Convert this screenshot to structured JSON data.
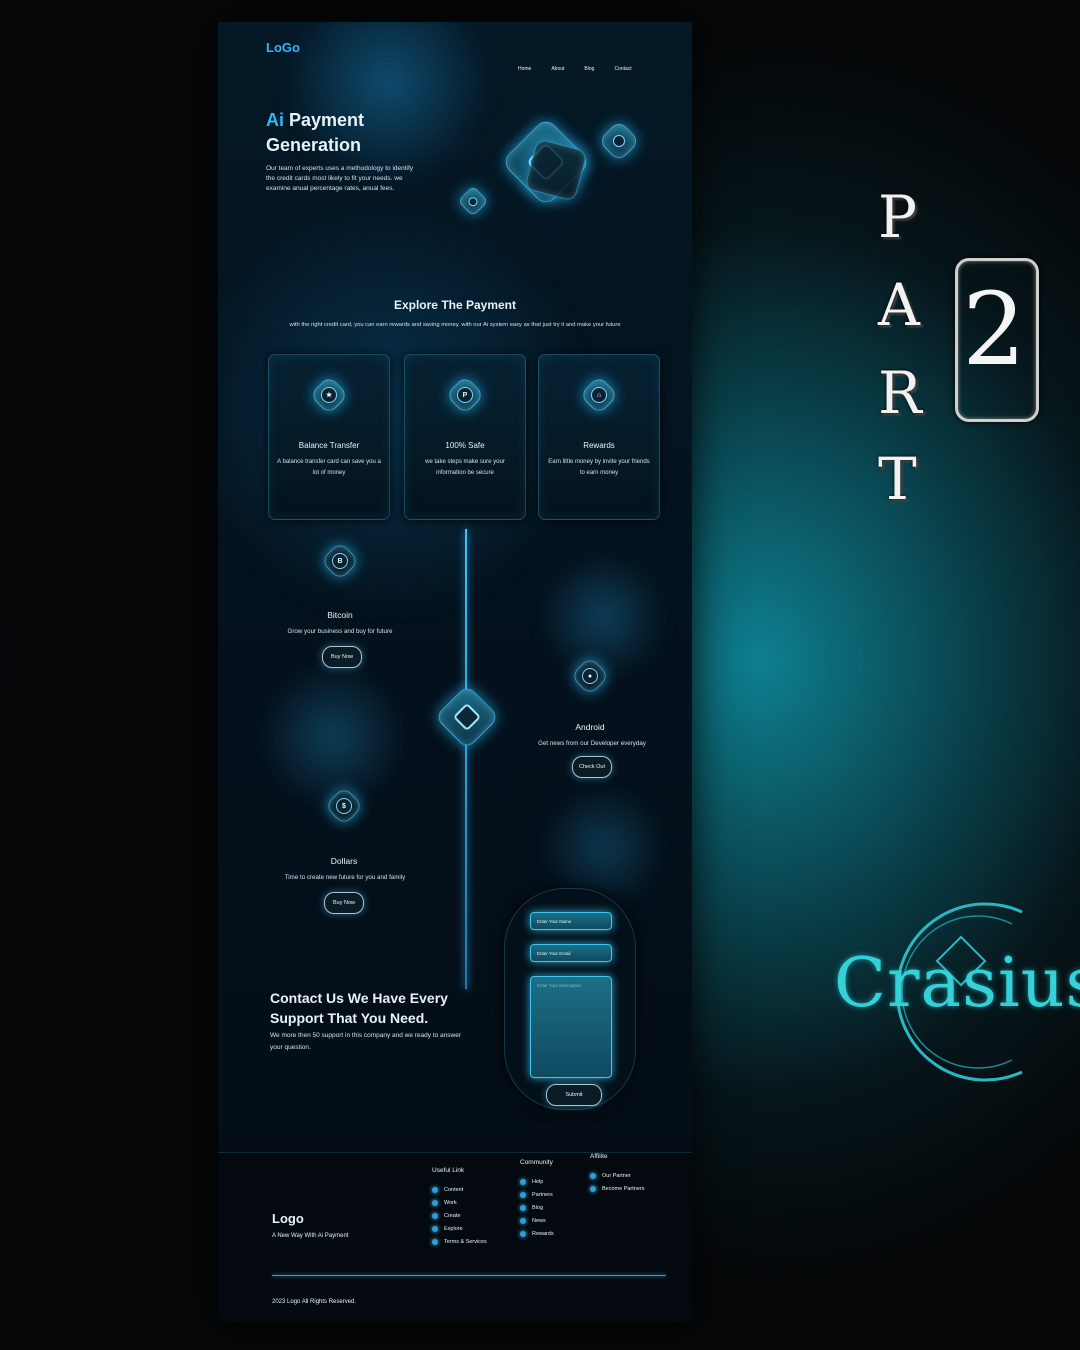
{
  "logo": {
    "part1": "Lo",
    "part2": "Go"
  },
  "nav": [
    "Home",
    "About",
    "Blog",
    "Contact"
  ],
  "hero": {
    "accent": "Ai",
    "title_rest": " Payment",
    "title_line2": "Generation",
    "description": "Our team of experts uses a methodology to identify the credit cards most likely to fit your needs. we examine anual percentage rates, anual fees."
  },
  "explore": {
    "title": "Explore The Payment",
    "subtitle": "with the right credit card, you can earn rewards and saving money. with our Ai system easy as that just try it and make your future"
  },
  "cards": [
    {
      "title": "Balance Transfer",
      "desc": "A balance transfer card can save you a lot of money",
      "icon": "★"
    },
    {
      "title": "100% Safe",
      "desc": "we take steps make sure your information be secure",
      "icon": "P"
    },
    {
      "title": "Rewards",
      "desc": "Earn little money by invite your friends to earn money",
      "icon": "⌂"
    }
  ],
  "features": [
    {
      "title": "Bitcoin",
      "desc": "Grow your business and buy for future",
      "button": "Buy Now",
      "icon": "B"
    },
    {
      "title": "Android",
      "desc": "Get news from our Developer everyday",
      "button": "Check Out",
      "icon": "●"
    },
    {
      "title": "Dollars",
      "desc": "Time to create new future for you and family",
      "button": "Buy Now",
      "icon": "$"
    }
  ],
  "contact": {
    "title": "Contact Us We Have Every Support That You Need.",
    "desc": "We more then 50 support in this company and we ready to answer your question.",
    "name_placeholder": "Enter Your Name",
    "email_placeholder": "Enter Your Email",
    "message_placeholder": "Enter Your Description",
    "submit": "Submit"
  },
  "footer": {
    "logo": "Logo",
    "tagline": "A New Way With Ai Payment",
    "columns": [
      {
        "title": "Useful Link",
        "items": [
          "Content",
          "Work",
          "Create",
          "Explore",
          "Terms & Services"
        ]
      },
      {
        "title": "Community",
        "items": [
          "Help",
          "Partners",
          "Blog",
          "News",
          "Rewards"
        ]
      },
      {
        "title": "Affilite",
        "items": [
          "Our Partner",
          "Become Partners"
        ]
      }
    ],
    "copyright": "2023 Logo All Rights Reserved."
  },
  "side": {
    "letters": [
      "P",
      "A",
      "R",
      "T"
    ],
    "number": "2",
    "brand": "Crasius"
  },
  "colors": {
    "accent": "#2fb6ff",
    "glow": "#35d0d8",
    "background": "#04111c"
  }
}
